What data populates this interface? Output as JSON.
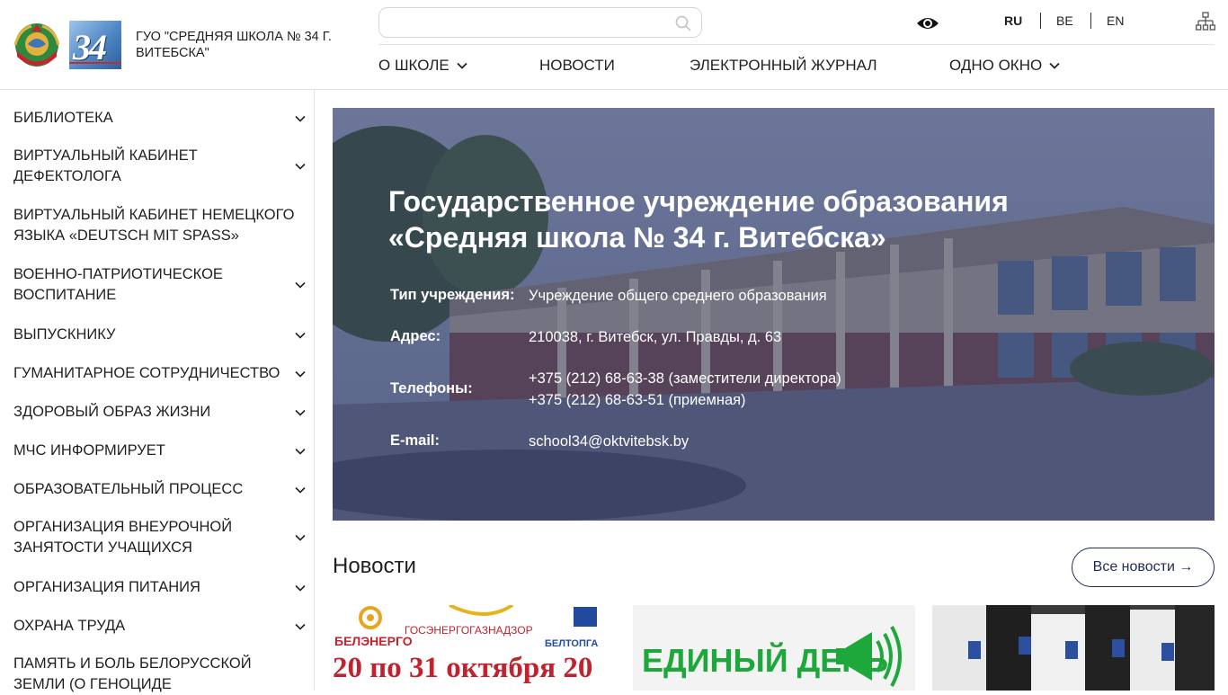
{
  "header": {
    "school_name": "ГУО \"СРЕДНЯЯ ШКОЛА № 34 Г. ВИТЕБСКА\"",
    "logo_text": "34",
    "search_placeholder": "",
    "search_value": "",
    "languages": [
      "RU",
      "BE",
      "EN"
    ],
    "active_language": "RU",
    "nav": [
      {
        "label": "О ШКОЛЕ",
        "has_dropdown": true
      },
      {
        "label": "НОВОСТИ",
        "has_dropdown": false
      },
      {
        "label": "ЭЛЕКТРОННЫЙ ЖУРНАЛ",
        "has_dropdown": false
      },
      {
        "label": "ОДНО ОКНО",
        "has_dropdown": true
      }
    ]
  },
  "sidebar": {
    "items": [
      {
        "label": "БИБЛИОТЕКА",
        "has_dropdown": true
      },
      {
        "label": "ВИРТУАЛЬНЫЙ КАБИНЕТ ДЕФЕКТОЛОГА",
        "has_dropdown": true
      },
      {
        "label": "ВИРТУАЛЬНЫЙ КАБИНЕТ НЕМЕЦКОГО ЯЗЫКА «DEUTSCH MIT SPASS»",
        "has_dropdown": false
      },
      {
        "label": "ВОЕННО-ПАТРИОТИЧЕСКОЕ ВОСПИТАНИЕ",
        "has_dropdown": true
      },
      {
        "label": "ВЫПУСКНИКУ",
        "has_dropdown": true
      },
      {
        "label": "ГУМАНИТАРНОЕ СОТРУДНИЧЕСТВО",
        "has_dropdown": true
      },
      {
        "label": "ЗДОРОВЫЙ ОБРАЗ ЖИЗНИ",
        "has_dropdown": true
      },
      {
        "label": "МЧС ИНФОРМИРУЕТ",
        "has_dropdown": true
      },
      {
        "label": "ОБРАЗОВАТЕЛЬНЫЙ ПРОЦЕСС",
        "has_dropdown": true
      },
      {
        "label": "ОРГАНИЗАЦИЯ ВНЕУРОЧНОЙ ЗАНЯТОСТИ УЧАЩИХСЯ",
        "has_dropdown": true
      },
      {
        "label": "ОРГАНИЗАЦИЯ ПИТАНИЯ",
        "has_dropdown": true
      },
      {
        "label": "ОХРАНА ТРУДА",
        "has_dropdown": true
      },
      {
        "label": "ПАМЯТЬ И БОЛЬ БЕЛОРУССКОЙ ЗЕМЛИ (О ГЕНОЦИДЕ",
        "has_dropdown": false
      }
    ]
  },
  "hero": {
    "title": "Государственное учреждение образования «Средняя школа № 34 г. Витебска»",
    "type_label": "Тип учреждения:",
    "type_value": "Учреждение общего среднего образования",
    "address_label": "Адрес:",
    "address_value": "210038, г. Витебск, ул. Правды, д. 63",
    "phones_label": "Телефоны:",
    "phone_1": "+375 (212) 68-63-38 (заместители директора)",
    "phone_2": "+375 (212) 68-63-51 (приемная)",
    "email_label": "E-mail:",
    "email_value": "school34@oktvitebsk.by"
  },
  "news": {
    "title": "Новости",
    "all_news_label": "Все новости →",
    "cards": [
      {
        "image_text_1": "ГОСЭНЕРГОГАЗНАДЗОР",
        "image_text_2": "БЕЛЭНЕРГО",
        "image_text_3": "БЕЛТОПГА",
        "image_text_4": "20 по 31 октября 20"
      },
      {
        "image_text_1": "ЕДИНЫЙ ДЕНЬ"
      },
      {
        "image_text_1": ""
      }
    ]
  },
  "colors": {
    "accent": "#1f2a5a",
    "hero_overlay": "#1f265a",
    "green": "#1ea83c",
    "red": "#c0232d"
  }
}
